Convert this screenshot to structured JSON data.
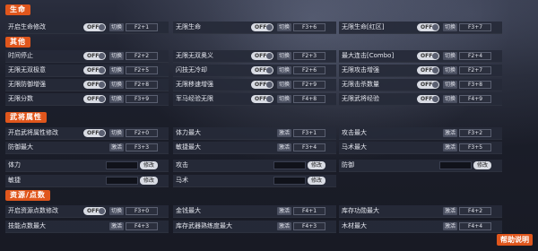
{
  "sections": {
    "life": "生命",
    "other": "其他",
    "general": "武将属性",
    "resource": "资源/点数"
  },
  "ui": {
    "off": "OFF",
    "switch": "切换",
    "activate": "激活",
    "modify": "修改",
    "help": "帮助说明"
  },
  "life_rows": [
    {
      "label": "开启生命修改",
      "hotkey": "F2+1"
    },
    {
      "label": "无限生命",
      "hotkey": "F3+6"
    },
    {
      "label": "无限生命[红区]",
      "hotkey": "F3+7"
    }
  ],
  "other_rows": [
    {
      "label": "时间停止",
      "hotkey": "F2+2"
    },
    {
      "label": "无限无双奥义",
      "hotkey": "F2+3"
    },
    {
      "label": "最大连击[Combo]",
      "hotkey": "F2+4"
    },
    {
      "label": "无限无双极意",
      "hotkey": "F2+5"
    },
    {
      "label": "闪技无冷却",
      "hotkey": "F2+6"
    },
    {
      "label": "无限攻击增强",
      "hotkey": "F2+7"
    },
    {
      "label": "无限防御增强",
      "hotkey": "F2+8"
    },
    {
      "label": "无限移速增强",
      "hotkey": "F2+9"
    },
    {
      "label": "无限击杀数量",
      "hotkey": "F3+8"
    },
    {
      "label": "无限分数",
      "hotkey": "F3+9"
    },
    {
      "label": "军马经验无限",
      "hotkey": "F4+8"
    },
    {
      "label": "无限武将经验",
      "hotkey": "F4+9"
    }
  ],
  "general_rows": [
    {
      "label": "开启武将属性修改",
      "hotkey": "F2+0"
    },
    {
      "label": "体力最大",
      "hotkey": "F3+1"
    },
    {
      "label": "攻击最大",
      "hotkey": "F3+2"
    },
    {
      "label": "防御最大",
      "hotkey": "F3+3"
    },
    {
      "label": "敏捷最大",
      "hotkey": "F3+4"
    },
    {
      "label": "马术最大",
      "hotkey": "F3+5"
    }
  ],
  "general_mod_rows": [
    {
      "label": "体力"
    },
    {
      "label": "攻击"
    },
    {
      "label": "防御"
    },
    {
      "label": "敏捷"
    },
    {
      "label": "马术"
    }
  ],
  "resource_rows": [
    {
      "label": "开启资源点数修改",
      "hotkey": "F3+0"
    },
    {
      "label": "金钱最大",
      "hotkey": "F4+1"
    },
    {
      "label": "库存功勋最大",
      "hotkey": "F4+2"
    },
    {
      "label": "技能点数最大",
      "hotkey": "F4+3"
    },
    {
      "label": "库存武器熟练度最大",
      "hotkey": "F4+3"
    },
    {
      "label": "木材最大",
      "hotkey": "F4+4"
    }
  ]
}
